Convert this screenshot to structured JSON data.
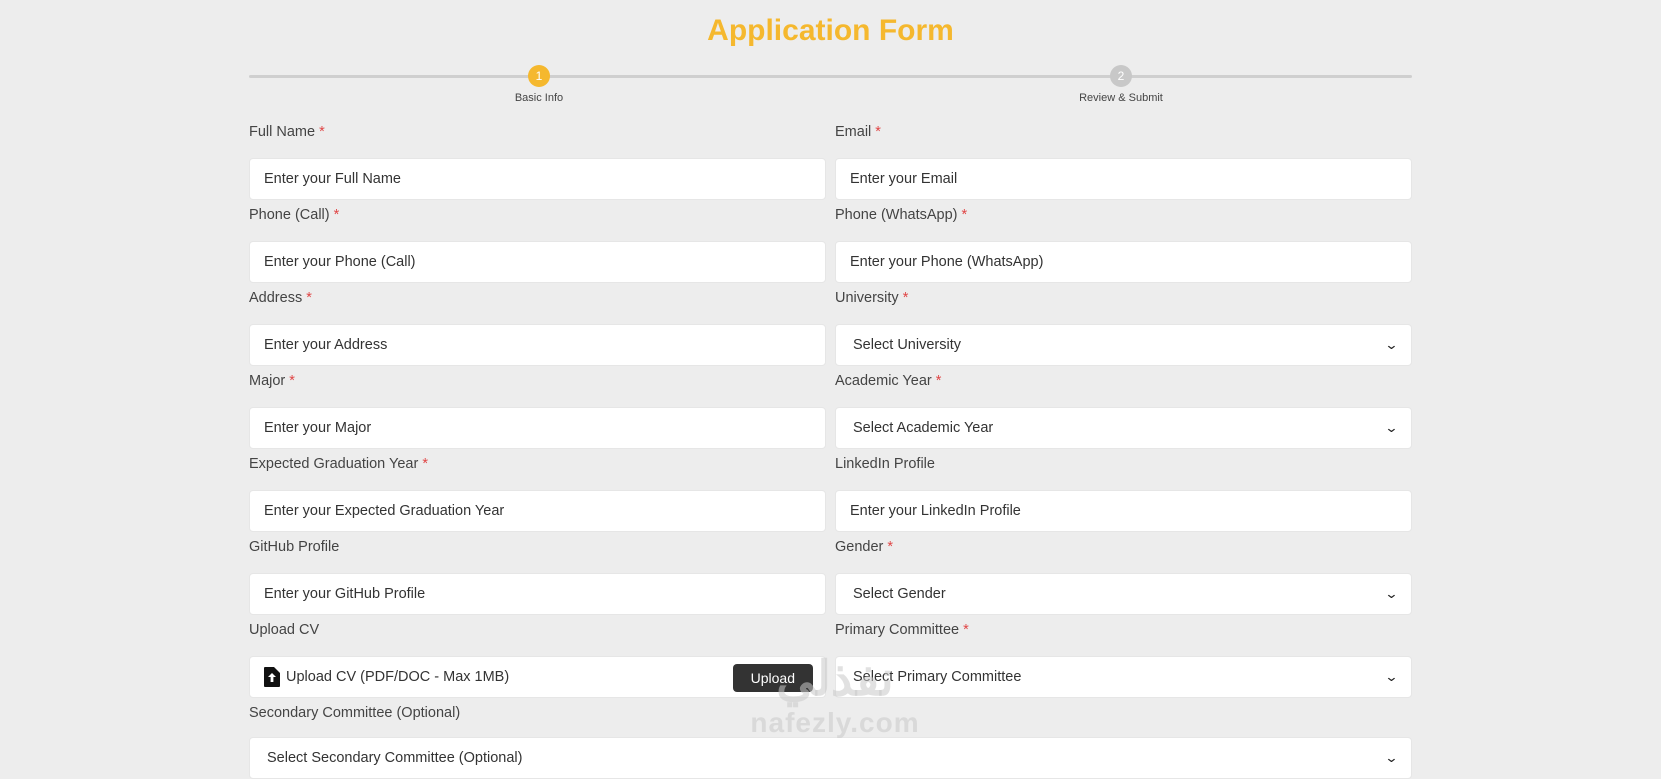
{
  "title": "Application Form",
  "steps": [
    {
      "number": "1",
      "label": "Basic Info",
      "active": true
    },
    {
      "number": "2",
      "label": "Review & Submit",
      "active": false
    }
  ],
  "fields": {
    "full_name": {
      "label": "Full Name",
      "required": "*",
      "placeholder": "Enter your Full Name"
    },
    "email": {
      "label": "Email",
      "required": "*",
      "placeholder": "Enter your Email"
    },
    "phone_call": {
      "label": "Phone (Call)",
      "required": "*",
      "placeholder": "Enter your Phone (Call)"
    },
    "phone_whatsapp": {
      "label": "Phone (WhatsApp)",
      "required": "*",
      "placeholder": "Enter your Phone (WhatsApp)"
    },
    "address": {
      "label": "Address",
      "required": "*",
      "placeholder": "Enter your Address"
    },
    "university": {
      "label": "University",
      "required": "*",
      "value": "Select University"
    },
    "major": {
      "label": "Major",
      "required": "*",
      "placeholder": "Enter your Major"
    },
    "academic_year": {
      "label": "Academic Year",
      "required": "*",
      "value": "Select Academic Year"
    },
    "graduation_year": {
      "label": "Expected Graduation Year",
      "required": "*",
      "placeholder": "Enter your Expected Graduation Year"
    },
    "linkedin": {
      "label": "LinkedIn Profile",
      "placeholder": "Enter your LinkedIn Profile"
    },
    "github": {
      "label": "GitHub Profile",
      "placeholder": "Enter your GitHub Profile"
    },
    "gender": {
      "label": "Gender",
      "required": "*",
      "value": "Select Gender"
    },
    "cv": {
      "label": "Upload CV",
      "text": "Upload CV (PDF/DOC - Max 1MB)",
      "button": "Upload"
    },
    "primary_committee": {
      "label": "Primary Committee",
      "required": "*",
      "value": "Select Primary Committee"
    },
    "secondary_committee": {
      "label": "Secondary Committee (Optional)",
      "value": "Select Secondary Committee (Optional)"
    }
  },
  "icons": {
    "chevron": "chevron-down-icon",
    "upload": "file-upload-icon"
  },
  "colors": {
    "accent": "#f5b82e",
    "required": "#e04545",
    "background": "#ededed",
    "button": "#333333"
  },
  "watermark": {
    "arabic": "نفذلي",
    "latin": "nafezly.com"
  }
}
